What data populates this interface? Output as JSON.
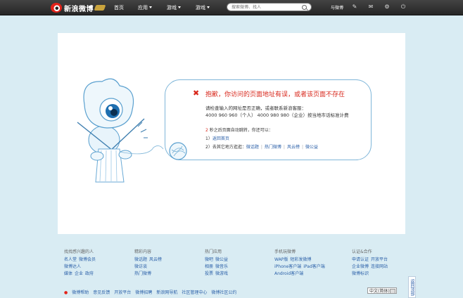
{
  "header": {
    "logo_text": "新浪微博",
    "nav": [
      {
        "label": "首页",
        "dropdown": false
      },
      {
        "label": "应用",
        "dropdown": true
      },
      {
        "label": "游戏",
        "dropdown": true
      },
      {
        "label": "游戏",
        "dropdown": true
      }
    ],
    "search_placeholder": "搜索微博、找人",
    "username": "与微博"
  },
  "error": {
    "title": "抱歉，你访问的页面地址有误，或者该页面不存在",
    "hint": "请检查输入的网址是否正确，或者联系新浪客服：",
    "phone": "4000 960 960（个人） 4000 980 980（企业）按当地市话标准计费",
    "countdown_num": "2",
    "countdown_text": "秒之后页面自动跳转，你还可以：",
    "opt1_num": "1）",
    "opt1_link": "返回首页",
    "opt2_num": "2）",
    "opt2_text": "去其它地方逛逛：",
    "opt2_links": [
      "微话题",
      "热门微博",
      "风云榜",
      "微公益"
    ]
  },
  "footer": {
    "columns": [
      {
        "heading": "找找感兴趣的人",
        "rows": [
          [
            "名人堂",
            "微博会员"
          ],
          [
            "微博达人"
          ],
          [
            "媒体",
            "企业",
            "政府"
          ]
        ]
      },
      {
        "heading": "精彩内容",
        "rows": [
          [
            "微话题",
            "风云榜"
          ],
          [
            "微访谈"
          ],
          [
            "热门微博"
          ]
        ]
      },
      {
        "heading": "热门应用",
        "rows": [
          [
            "微吧",
            "微公益"
          ],
          [
            "相册",
            "微音乐"
          ],
          [
            "投票",
            "微游戏"
          ]
        ]
      },
      {
        "heading": "手机玩微博",
        "rows": [
          [
            "WAP版",
            "短彩发微博"
          ],
          [
            "iPhone客户端",
            "iPad客户端"
          ],
          [
            "Android客户端"
          ]
        ]
      },
      {
        "heading": "认证&合作",
        "rows": [
          [
            "申请认证",
            "开放平台"
          ],
          [
            "企业微博",
            "连接网站"
          ],
          [
            "微博标识"
          ]
        ]
      }
    ],
    "bottom_links": [
      "微博帮助",
      "意见反馈",
      "开放平台",
      "微博招聘",
      "新浪网导航",
      "社区管理中心",
      "微博社区公约"
    ],
    "language": "中文(简体)",
    "back_to_top": "返回顶部"
  },
  "colors": {
    "topbar": "#333333",
    "background": "#d9ecf3",
    "error_red": "#d8281c",
    "link_blue": "#2a5fa8",
    "bubble_border": "#7fb6d9"
  }
}
